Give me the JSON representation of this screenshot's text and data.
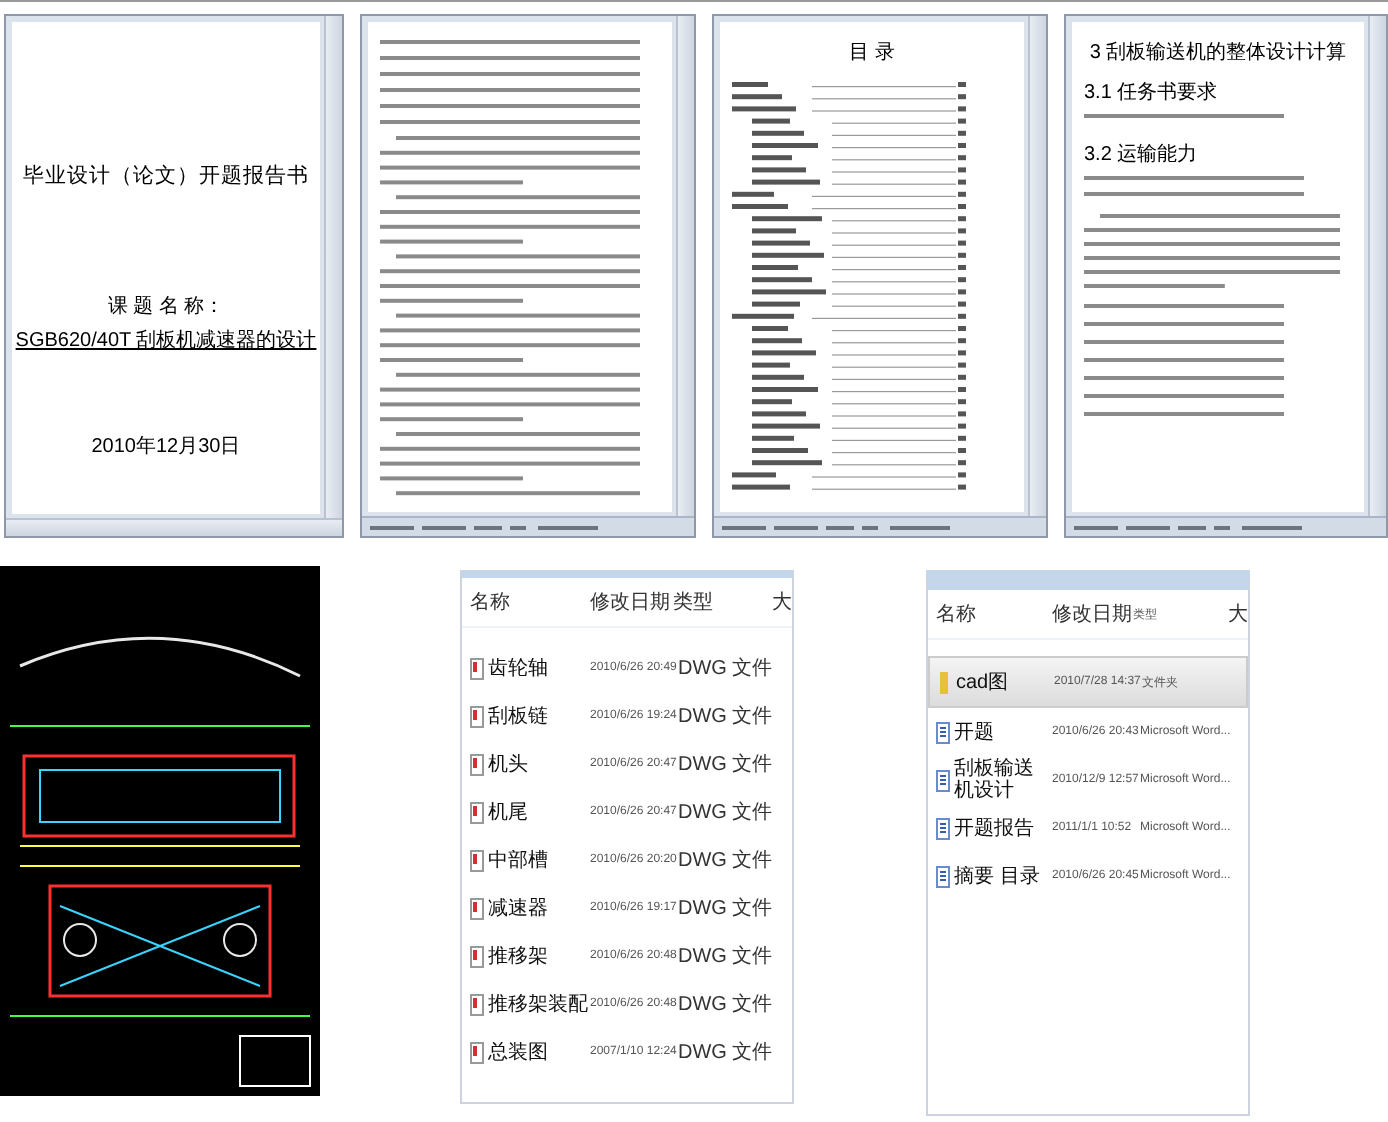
{
  "documents": [
    {
      "kind": "cover",
      "title": "毕业设计（论文）开题报告书",
      "subject_label": "课 题 名 称：",
      "subject": "SGB620/40T 刮板机减速器的设计",
      "date": "2010年12月30日"
    },
    {
      "kind": "body"
    },
    {
      "kind": "toc",
      "title": "目 录"
    },
    {
      "kind": "chapter",
      "title": "3 刮板输送机的整体设计计算",
      "sections": [
        "3.1 任务书要求",
        "3.2 运输能力"
      ]
    }
  ],
  "file_lists": [
    {
      "columns": [
        "名称",
        "修改日期",
        "类型",
        "大"
      ],
      "rows": [
        {
          "kind": "dwg",
          "name": "齿轮轴",
          "modified": "2010/6/26 20:49",
          "type": "DWG 文件",
          "selected": false
        },
        {
          "kind": "dwg",
          "name": "刮板链",
          "modified": "2010/6/26 19:24",
          "type": "DWG 文件",
          "selected": false
        },
        {
          "kind": "dwg",
          "name": "机头",
          "modified": "2010/6/26 20:47",
          "type": "DWG 文件",
          "selected": false
        },
        {
          "kind": "dwg",
          "name": "机尾",
          "modified": "2010/6/26 20:47",
          "type": "DWG 文件",
          "selected": false
        },
        {
          "kind": "dwg",
          "name": "中部槽",
          "modified": "2010/6/26 20:20",
          "type": "DWG 文件",
          "selected": false
        },
        {
          "kind": "dwg",
          "name": "减速器",
          "modified": "2010/6/26 19:17",
          "type": "DWG 文件",
          "selected": false
        },
        {
          "kind": "dwg",
          "name": "推移架",
          "modified": "2010/6/26 20:48",
          "type": "DWG 文件",
          "selected": false
        },
        {
          "kind": "dwg",
          "name": "推移架装配",
          "modified": "2010/6/26 20:48",
          "type": "DWG 文件",
          "selected": false
        },
        {
          "kind": "dwg",
          "name": "总装图",
          "modified": "2007/1/10 12:24",
          "type": "DWG 文件",
          "selected": false
        }
      ]
    },
    {
      "columns": [
        "名称",
        "修改日期",
        "类型",
        "大"
      ],
      "rows": [
        {
          "kind": "folder",
          "name": "cad图",
          "modified": "2010/7/28 14:37",
          "type": "文件夹",
          "selected": true
        },
        {
          "kind": "word",
          "name": "开题",
          "modified": "2010/6/26 20:43",
          "type": "Microsoft Word...",
          "selected": false
        },
        {
          "kind": "word",
          "name": "刮板输送机设计",
          "modified": "2010/12/9 12:57",
          "type": "Microsoft Word...",
          "selected": false
        },
        {
          "kind": "word",
          "name": "开题报告",
          "modified": "2011/1/1 10:52",
          "type": "Microsoft Word...",
          "selected": false
        },
        {
          "kind": "word",
          "name": "摘要 目录",
          "modified": "2010/6/26 20:45",
          "type": "Microsoft Word...",
          "selected": false
        }
      ]
    }
  ]
}
